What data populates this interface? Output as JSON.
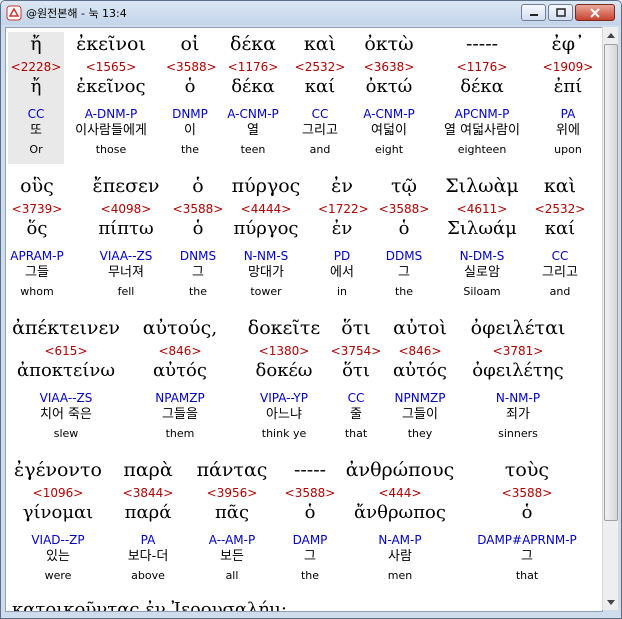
{
  "window": {
    "title": "@원전본해 - 눅 13:4",
    "minimize_icon": "minimize-icon",
    "maximize_icon": "maximize-icon",
    "close_icon": "close-icon"
  },
  "rows": [
    {
      "words": [
        {
          "greek": "ἤ",
          "strong": "<2228>",
          "lemma": "ἤ",
          "morph": "CC",
          "korean": "또",
          "english": "Or"
        },
        {
          "greek": "ἐκεῖνοι",
          "strong": "<1565>",
          "lemma": "ἐκεῖνος",
          "morph": "A-DNM-P",
          "korean": "이사람들에게",
          "english": "those"
        },
        {
          "greek": "οἱ",
          "strong": "<3588>",
          "lemma": "ὁ",
          "morph": "DNMP",
          "korean": "이",
          "english": "the"
        },
        {
          "greek": "δέκα",
          "strong": "<1176>",
          "lemma": "δέκα",
          "morph": "A-CNM-P",
          "korean": "열",
          "english": "teen"
        },
        {
          "greek": "καὶ",
          "strong": "<2532>",
          "lemma": "καί",
          "morph": "CC",
          "korean": "그리고",
          "english": "and"
        },
        {
          "greek": "ὀκτὼ",
          "strong": "<3638>",
          "lemma": "ὀκτώ",
          "morph": "A-CNM-P",
          "korean": "여덟이",
          "english": "eight"
        },
        {
          "greek": "-----",
          "strong": "<1176>",
          "lemma": "δέκα",
          "morph": "APCNM-P",
          "korean": "열 여덟사람이",
          "english": "eighteen"
        },
        {
          "greek": "ἐφ᾽",
          "strong": "<1909>",
          "lemma": "ἐπί",
          "morph": "PA",
          "korean": "위에",
          "english": "upon"
        }
      ]
    },
    {
      "words": [
        {
          "greek": "οὓς",
          "strong": "<3739>",
          "lemma": "ὅς",
          "morph": "APRAM-P",
          "korean": "그들",
          "english": "whom"
        },
        {
          "greek": "ἔπεσεν",
          "strong": "<4098>",
          "lemma": "πίπτω",
          "morph": "VIAA--ZS",
          "korean": "무너져",
          "english": "fell"
        },
        {
          "greek": "ὁ",
          "strong": "<3588>",
          "lemma": "ὁ",
          "morph": "DNMS",
          "korean": "그",
          "english": "the"
        },
        {
          "greek": "πύργος",
          "strong": "<4444>",
          "lemma": "πύργος",
          "morph": "N-NM-S",
          "korean": "망대가",
          "english": "tower"
        },
        {
          "greek": "ἐν",
          "strong": "<1722>",
          "lemma": "ἐν",
          "morph": "PD",
          "korean": "에서",
          "english": "in"
        },
        {
          "greek": "τῷ",
          "strong": "<3588>",
          "lemma": "ὁ",
          "morph": "DDMS",
          "korean": "그",
          "english": "the"
        },
        {
          "greek": "Σιλωὰμ",
          "strong": "<4611>",
          "lemma": "Σιλωάμ",
          "morph": "N-DM-S",
          "korean": "실로암",
          "english": "Siloam"
        },
        {
          "greek": "καὶ",
          "strong": "<2532>",
          "lemma": "καί",
          "morph": "CC",
          "korean": "그리고",
          "english": "and"
        }
      ]
    },
    {
      "words": [
        {
          "greek": "ἀπέκτεινεν",
          "strong": "<615>",
          "lemma": "ἀποκτείνω",
          "morph": "VIAA--ZS",
          "korean": "치어 죽은",
          "english": "slew"
        },
        {
          "greek": "αὐτούς,",
          "strong": "<846>",
          "lemma": "αὐτός",
          "morph": "NPAMZP",
          "korean": "그들을",
          "english": "them"
        },
        {
          "greek": "δοκεῖτε",
          "strong": "<1380>",
          "lemma": "δοκέω",
          "morph": "VIPA--YP",
          "korean": "아느냐",
          "english": "think ye"
        },
        {
          "greek": "ὅτι",
          "strong": "<3754>",
          "lemma": "ὅτι",
          "morph": "CC",
          "korean": "줄",
          "english": "that"
        },
        {
          "greek": "αὐτοὶ",
          "strong": "<846>",
          "lemma": "αὐτός",
          "morph": "NPNMZP",
          "korean": "그들이",
          "english": "they"
        },
        {
          "greek": "ὀφειλέται",
          "strong": "<3781>",
          "lemma": "ὀφειλέτης",
          "morph": "N-NM-P",
          "korean": "죄가",
          "english": "sinners"
        }
      ]
    },
    {
      "words": [
        {
          "greek": "ἐγένοντο",
          "strong": "<1096>",
          "lemma": "γίνομαι",
          "morph": "VIAD--ZP",
          "korean": "있는",
          "english": "were"
        },
        {
          "greek": "παρὰ",
          "strong": "<3844>",
          "lemma": "παρά",
          "morph": "PA",
          "korean": "보다-더",
          "english": "above"
        },
        {
          "greek": "πάντας",
          "strong": "<3956>",
          "lemma": "πᾶς",
          "morph": "A--AM-P",
          "korean": "보든",
          "english": "all"
        },
        {
          "greek": "-----",
          "strong": "<3588>",
          "lemma": "ὁ",
          "morph": "DAMP",
          "korean": "그",
          "english": "the"
        },
        {
          "greek": "ἀνθρώπους",
          "strong": "<444>",
          "lemma": "ἄνθρωπος",
          "morph": "N-AM-P",
          "korean": "사람",
          "english": "men"
        },
        {
          "greek": "τοὺς",
          "strong": "<3588>",
          "lemma": "ὁ",
          "morph": "DAMP#APRNM-P",
          "korean": "그",
          "english": "that"
        }
      ]
    }
  ],
  "partial_line": "κατοικοῦντας   ἐν   Ἰερουσαλήμ;"
}
